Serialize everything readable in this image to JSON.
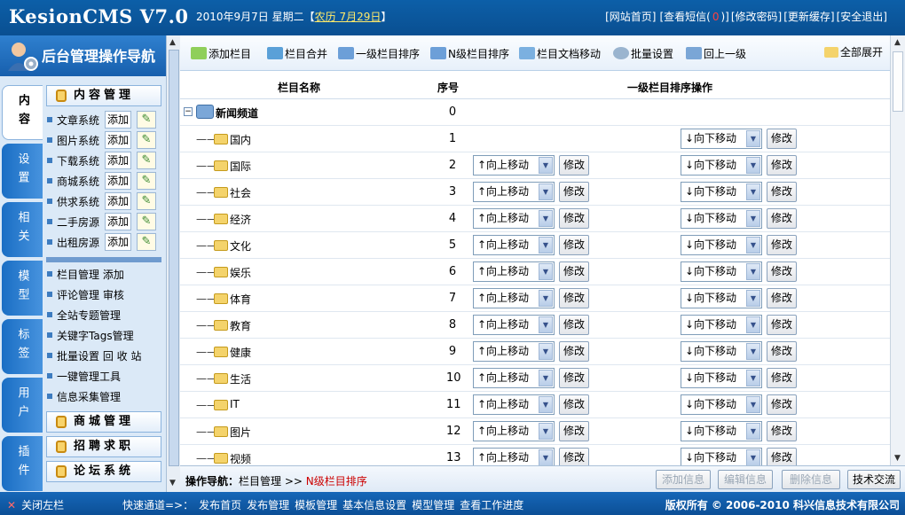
{
  "header": {
    "logo": "KesionCMS V7.0",
    "date": "2010年9月7日 星期二【",
    "lunar": "农历 7月29日",
    "date_end": "】",
    "links": [
      "[网站首页]",
      "[查看短信(",
      "0",
      ")]",
      "[修改密码]",
      "[更新缓存]",
      "[安全退出]"
    ]
  },
  "sidebar": {
    "title": "后台管理操作导航",
    "tabs": [
      "内容",
      "设置",
      "相关",
      "模型",
      "标签",
      "用户",
      "插件"
    ],
    "active_tab": "内容",
    "section_head": "内容管理",
    "add_label": "添加",
    "systems": [
      "文章系统",
      "图片系统",
      "下载系统",
      "商城系统",
      "供求系统",
      "二手房源",
      "出租房源"
    ],
    "links": [
      "栏目管理 添加",
      "评论管理 审核",
      "全站专题管理",
      "关键字Tags管理",
      "批量设置 回 收 站",
      "一键管理工具",
      "信息采集管理"
    ],
    "more_sections": [
      "商城管理",
      "招聘求职",
      "论坛系统"
    ]
  },
  "toolbar": {
    "items": [
      "添加栏目",
      "栏目合并",
      "一级栏目排序",
      "N级栏目排序",
      "栏目文档移动",
      "批量设置",
      "回上一级"
    ],
    "expand_all": "全部展开"
  },
  "table": {
    "headers": [
      "栏目名称",
      "序号",
      "一级栏目排序操作"
    ],
    "root": {
      "name": "新闻频道",
      "num": "0"
    },
    "tree_prefix": "——",
    "up_label": "↑向上移动",
    "down_label": "↓向下移动",
    "edit_label": "修改",
    "rows": [
      {
        "name": "国内",
        "num": "1"
      },
      {
        "name": "国际",
        "num": "2"
      },
      {
        "name": "社会",
        "num": "3"
      },
      {
        "name": "经济",
        "num": "4"
      },
      {
        "name": "文化",
        "num": "5"
      },
      {
        "name": "娱乐",
        "num": "6"
      },
      {
        "name": "体育",
        "num": "7"
      },
      {
        "name": "教育",
        "num": "8"
      },
      {
        "name": "健康",
        "num": "9"
      },
      {
        "name": "生活",
        "num": "10"
      },
      {
        "name": "IT",
        "num": "11"
      },
      {
        "name": "图片",
        "num": "12"
      },
      {
        "name": "视频",
        "num": "13"
      }
    ]
  },
  "opbar": {
    "label": "操作导航：",
    "crumb": "栏目管理",
    "sep": ">>",
    "current": "N级栏目排序",
    "buttons": [
      "添加信息",
      "编辑信息",
      "删除信息",
      "技术交流"
    ]
  },
  "footer": {
    "close": "关闭左栏",
    "quick_label": "快速通道=>：",
    "quick_links": [
      "发布首页",
      "发布管理",
      "模板管理",
      "基本信息设置",
      "模型管理",
      "查看工作进度"
    ],
    "copyright": "版权所有 © 2006-2010 科兴信息技术有限公司"
  },
  "colors": {
    "header_blue": "#0c5fa8",
    "sidebar_bg": "#dbe9f7",
    "crumb_red": "#cc0000"
  }
}
